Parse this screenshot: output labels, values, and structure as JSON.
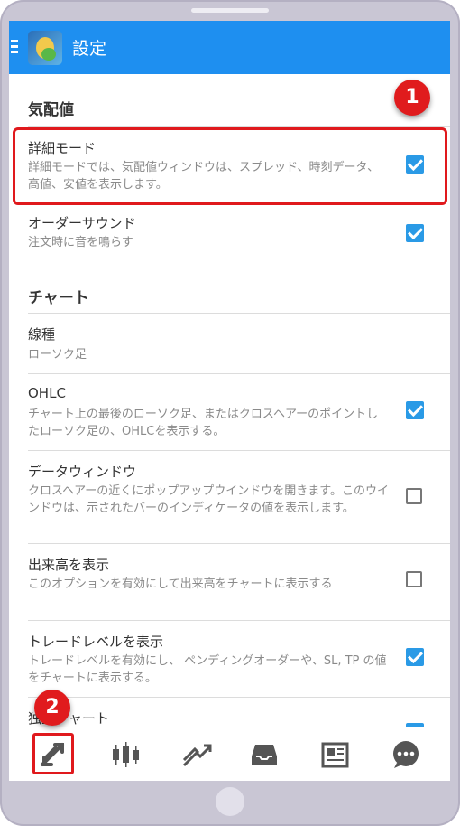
{
  "appbar": {
    "title": "設定"
  },
  "sections": [
    {
      "title": "気配値"
    },
    {
      "title": "チャート"
    }
  ],
  "items": [
    {
      "title": "詳細モード",
      "desc": "詳細モードでは、気配値ウィンドウは、スプレッド、時刻データ、高値、安値を表示します。",
      "checked": true
    },
    {
      "title": "オーダーサウンド",
      "desc": "注文時に音を鳴らす",
      "checked": true
    },
    {
      "title": "線種",
      "desc": "ローソク足"
    },
    {
      "title": "OHLC",
      "desc": "チャート上の最後のローソク足、またはクロスヘアーのポイントしたローソク足の、OHLCを表示する。",
      "checked": true
    },
    {
      "title": "データウィンドウ",
      "desc": "クロスヘアーの近くにポップアップウインドウを開きます。このウインドウは、示されたバーのインディケータの値を表示します。",
      "checked": false
    },
    {
      "title": "出来高を表示",
      "desc": "このオプションを有効にして出来高をチャートに表示する",
      "checked": false
    },
    {
      "title": "トレードレベルを表示",
      "desc": "トレードレベルを有効にし、 ペンディングオーダーや、SL, TP の値をチャートに表示する。",
      "checked": true
    },
    {
      "title": "独立チャート"
    }
  ],
  "badges": {
    "first": "1",
    "second": "2"
  },
  "bottom_nav": [
    {
      "icon": "quotes-arrows-icon"
    },
    {
      "icon": "candlestick-chart-icon"
    },
    {
      "icon": "trade-icon"
    },
    {
      "icon": "history-inbox-icon"
    },
    {
      "icon": "news-icon"
    },
    {
      "icon": "chat-icon"
    }
  ],
  "colors": {
    "accent": "#1e8ff0",
    "highlight": "#e0191d",
    "checkbox": "#2a9ae6"
  }
}
